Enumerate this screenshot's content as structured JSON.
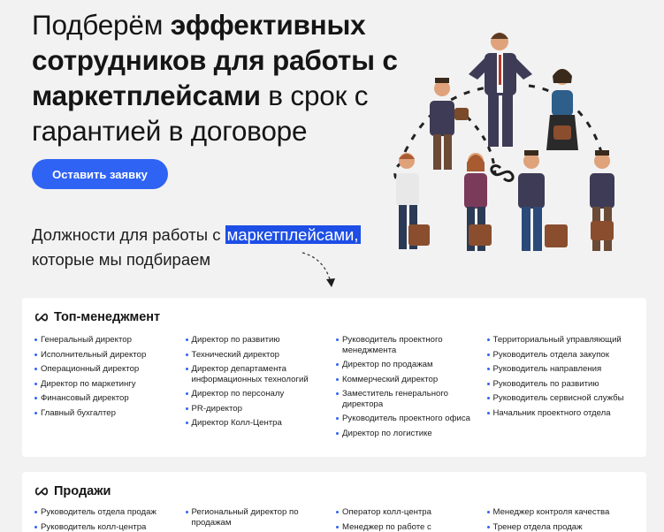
{
  "hero": {
    "title_part1": "Подберём ",
    "title_bold": "эффективных сотрудников для работы с маркетплейсами",
    "title_part2": " в срок с гарантией в договоре",
    "cta_label": "Оставить заявку"
  },
  "positions": {
    "text_before": "Должности для работы с ",
    "text_highlight": "маркетплейсами,",
    "text_after": "которые мы подбираем"
  },
  "colors": {
    "accent": "#2f63f4",
    "highlight": "#1d4ee6",
    "background": "#f2f2f2",
    "card": "#ffffff"
  },
  "icons": {
    "section_icon": "infinity-logo-icon",
    "arrow": "dashed-arrow-icon",
    "illustration": "team-pyramid-illustration"
  },
  "sections": [
    {
      "title": "Топ-менеджмент",
      "columns": [
        [
          "Генеральный директор",
          "Исполнительный директор",
          "Операционный директор",
          "Директор по маркетингу",
          "Финансовый директор",
          "Главный бухгалтер"
        ],
        [
          "Директор по развитию",
          "Технический директор",
          "Директор департамента информационных технологий",
          "Директор по персоналу",
          "PR-директор",
          "Директор Колл-Центра"
        ],
        [
          "Руководитель проектного менеджмента",
          "Директор по продажам",
          "Коммерческий директор",
          "Заместитель генерального директора",
          "Руководитель проектного офиса",
          "Директор по логистике"
        ],
        [
          "Территориальный управляющий",
          "Руководитель отдела закупок",
          "Руководитель направления",
          "Руководитель по развитию",
          "Руководитель сервисной службы",
          "Начальник проектного отдела"
        ]
      ]
    },
    {
      "title": "Продажи",
      "columns": [
        [
          "Руководитель отдела продаж",
          "Руководитель колл-центра"
        ],
        [
          "Региональный директор по продажам"
        ],
        [
          "Оператор колл-центра",
          "Менеджер по работе с"
        ],
        [
          "Менеджер контроля качества",
          "Тренер отдела продаж"
        ]
      ]
    }
  ]
}
